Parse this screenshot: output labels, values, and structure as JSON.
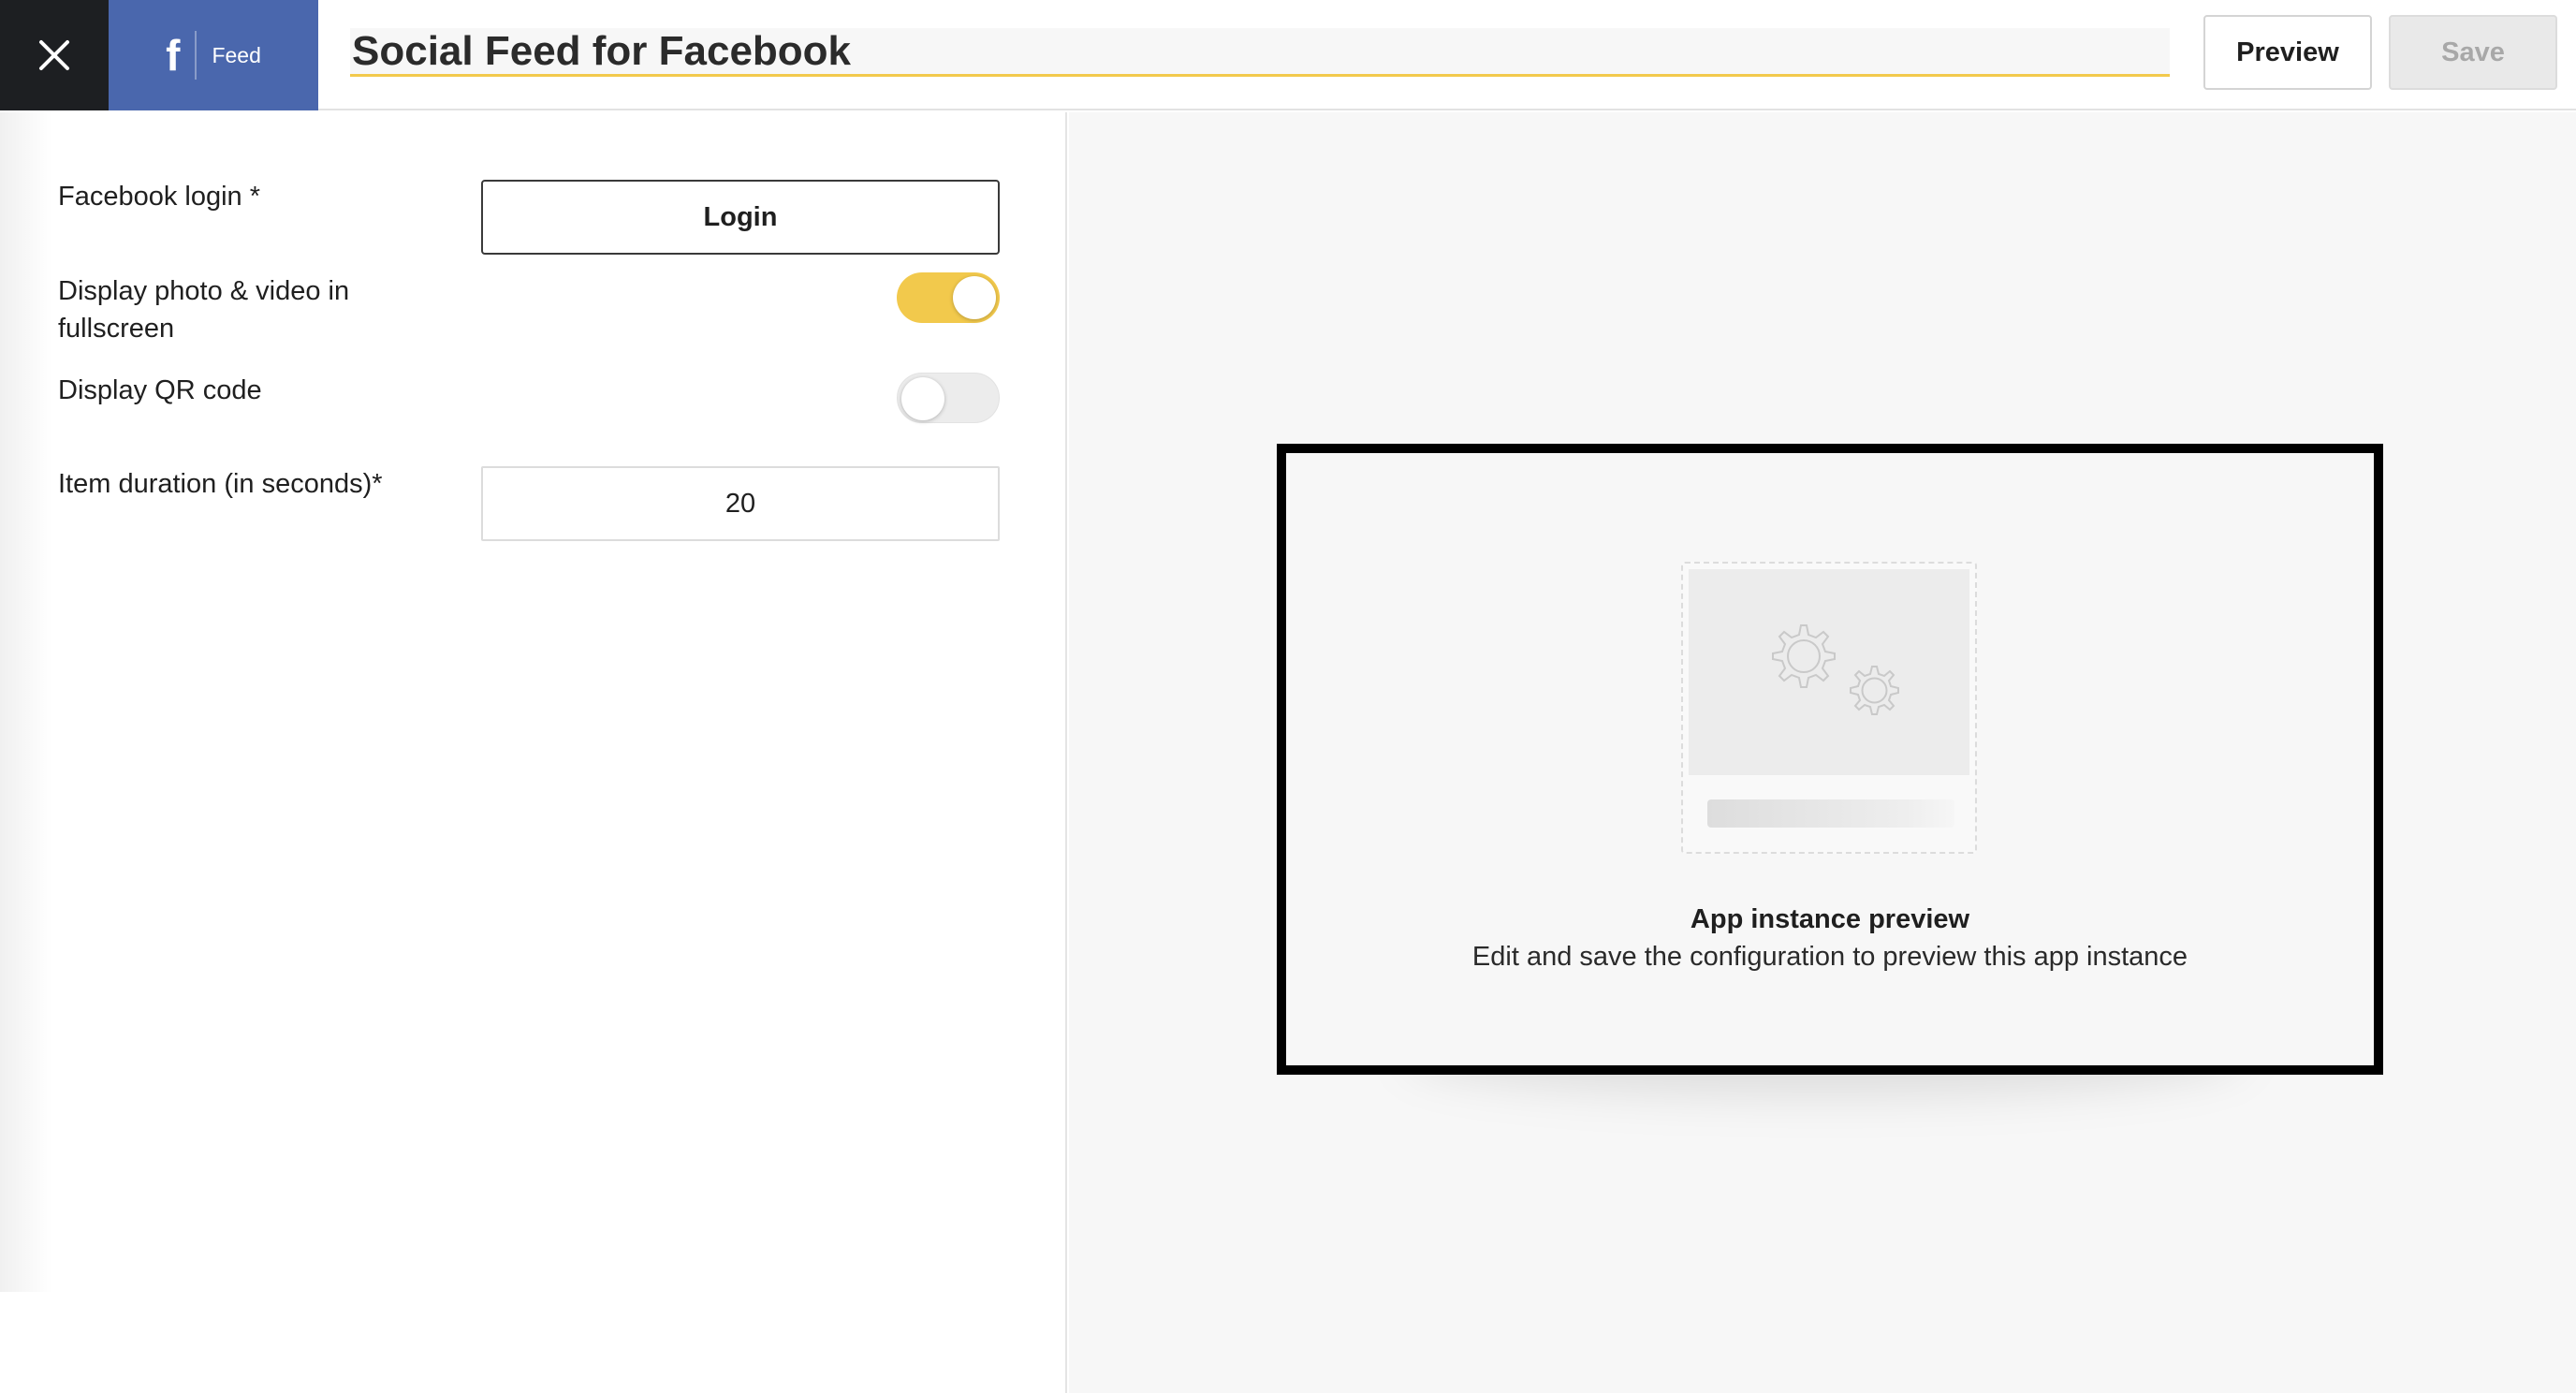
{
  "header": {
    "close_icon": "close-icon",
    "brand_icon": "facebook-icon",
    "brand_glyph": "f",
    "brand_label": "Feed",
    "title_value": "Social Feed for Facebook",
    "preview_label": "Preview",
    "save_label": "Save",
    "accent_color": "#f2c94c",
    "brand_color": "#4a67ad"
  },
  "form": {
    "facebook_login_label": "Facebook login *",
    "login_button_label": "Login",
    "fullscreen_label_line1": "Display photo & video in",
    "fullscreen_label_line2": "fullscreen",
    "fullscreen_enabled": true,
    "qr_label": "Display QR code",
    "qr_enabled": false,
    "duration_label": "Item duration (in seconds)*",
    "duration_value": "20"
  },
  "preview": {
    "placeholder_icon": "gears-icon",
    "title": "App instance preview",
    "subtitle": "Edit and save the configuration to preview this app instance"
  }
}
